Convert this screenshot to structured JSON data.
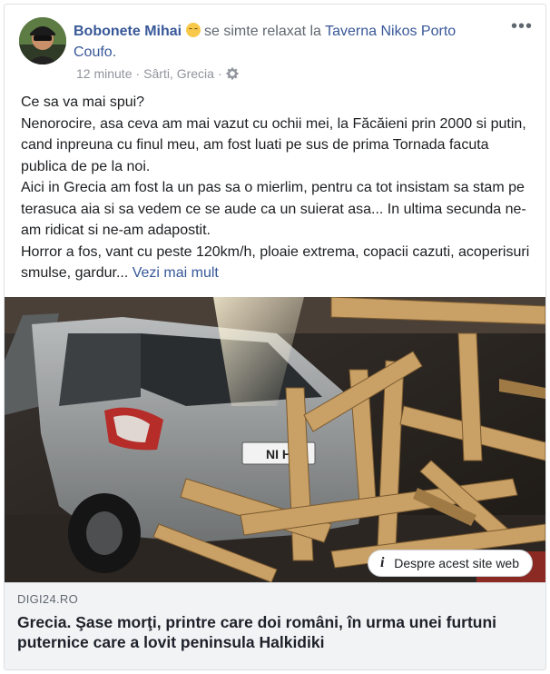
{
  "header": {
    "author": "Bobonete Mihai",
    "feeling_text": "se simte relaxat la",
    "place": "Taverna Nikos Porto Coufo.",
    "time": "12 minute",
    "separator": "·",
    "location": "Sârti, Grecia",
    "privacy_icon": "gear-icon",
    "more_label": "•••",
    "emoji_icon": "relieved-face-emoji"
  },
  "post": {
    "lines": [
      "Ce sa va mai spui?",
      "Nenorocire, asa ceva am mai vazut cu ochii mei, la Făcăieni prin 2000 si putin, cand inpreuna cu finul meu, am fost luati pe sus de prima Tornada facuta publica de pe la noi.",
      "Aici in Grecia am fost la un pas sa o mierlim, pentru ca tot insistam sa stam pe terasuca aia si sa vedem ce se aude ca un suierat asa... In ultima secunda ne-am ridicat si ne-am adapostit."
    ],
    "last_line": "Horror a fos, vant cu peste 120km/h, ploaie extrema, copacii cazuti, acoperisuri smulse, gardur...",
    "see_more": "Vezi mai mult"
  },
  "link": {
    "site_info_label": "Despre acest site web",
    "domain": "DIGI24.RO",
    "title": "Grecia. Şase morţi, printre care doi români, în urma unei furtuni puternice care a lovit peninsula Halkidiki"
  },
  "image": {
    "plate_text": "NI  H"
  }
}
